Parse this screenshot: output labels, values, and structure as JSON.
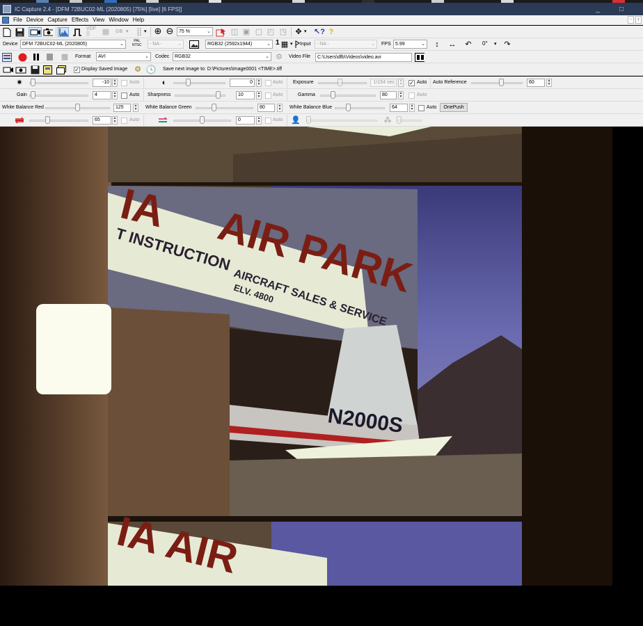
{
  "window": {
    "title": "IC Capture 2.4 - [DFM 72BUC02-ML (2020805) [75%] [live] [6 FPS]]",
    "minimize_glyph": "_",
    "maximize_glyph": "□"
  },
  "menu": [
    "File",
    "Device",
    "Capture",
    "Effects",
    "View",
    "Window",
    "Help"
  ],
  "mdi_glyphs": [
    "-",
    "r"
  ],
  "toolbar1": {
    "gb_label": "GB",
    "zoom_value": "75 %",
    "zoom_options": [
      "75 %"
    ]
  },
  "toolbar2": {
    "device_label": "Device",
    "device_value": "DFM 72BUC02-ML (2020805)",
    "videonorm_icon_text_top": "PAL",
    "videonorm_icon_text_bottom": "NTSC",
    "videonorm_value": "- NA -",
    "format_value": "RGB32 (2592x1944)",
    "count_value": "1",
    "input_label": "Input",
    "input_value": "- NA -",
    "fps_label": "FPS",
    "fps_value": "5.99",
    "rotate_label": "0°"
  },
  "toolbar3": {
    "format_label": "Format",
    "format_value": "AVI",
    "codec_label": "Codec",
    "codec_value": "RGB32",
    "video_file_label": "Video File",
    "video_file_value": "C:\\Users\\dfb\\Videos\\video.avi"
  },
  "toolbar4": {
    "display_saved_image_label": "Display Saved Image",
    "display_saved_image_checked": true,
    "save_next_label": "Save next image to: D:\\Pictures\\Image0001 <TIME>.tiff"
  },
  "properties": {
    "auto_label": "Auto",
    "brightness": {
      "value": "-10",
      "auto": false,
      "level": 0.02
    },
    "contrast": {
      "value": "0",
      "auto": false,
      "level": 0.27
    },
    "exposure": {
      "label": "Exposure",
      "value": "1/154 sec",
      "auto": true,
      "level": 0.45
    },
    "auto_reference": {
      "label": "Auto Reference",
      "value": "60",
      "level": 0.6
    },
    "gain": {
      "label": "Gain",
      "value": "4",
      "auto": false,
      "level": 0.02
    },
    "sharpness": {
      "label": "Sharpness",
      "value": "10",
      "auto": false,
      "level": 0.9
    },
    "gamma": {
      "label": "Gamma",
      "value": "80",
      "auto": false,
      "level": 0.2
    },
    "wb_red": {
      "label": "White Balance Red",
      "value": "125",
      "level": 0.5
    },
    "wb_green": {
      "label": "White Balance Green",
      "value": "80",
      "level": 0.3
    },
    "wb_blue": {
      "label": "White Balance Blue",
      "value": "64",
      "auto": false,
      "level": 0.25
    },
    "onepush_label": "OnePush",
    "red_green_balance": {
      "value": "65",
      "auto": false,
      "level": 0.3
    },
    "magenta_green_balance": {
      "value": "0",
      "auto": false,
      "level": 0.5
    }
  },
  "colors": {
    "titlebar": "#2b3a55",
    "toolbar_bg": "#f0f0f0",
    "record_red": "#e21b1b"
  }
}
